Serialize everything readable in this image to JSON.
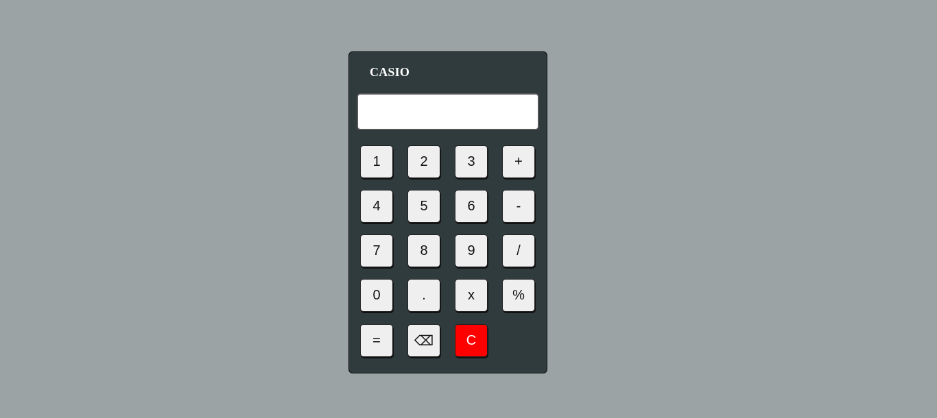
{
  "calculator": {
    "brand": "CASIO",
    "display": {
      "value": "",
      "placeholder": ""
    },
    "keys": [
      [
        "1",
        "2",
        "3",
        "+"
      ],
      [
        "4",
        "5",
        "6",
        "-"
      ],
      [
        "7",
        "8",
        "9",
        "/"
      ],
      [
        "0",
        ".",
        "x",
        "%"
      ],
      [
        "=",
        "⌫",
        "C"
      ]
    ]
  },
  "colors": {
    "page_background": "#9ba3a5",
    "body": "#2f3b3c",
    "key": "#efefef",
    "clear_key": "#ff0000"
  }
}
